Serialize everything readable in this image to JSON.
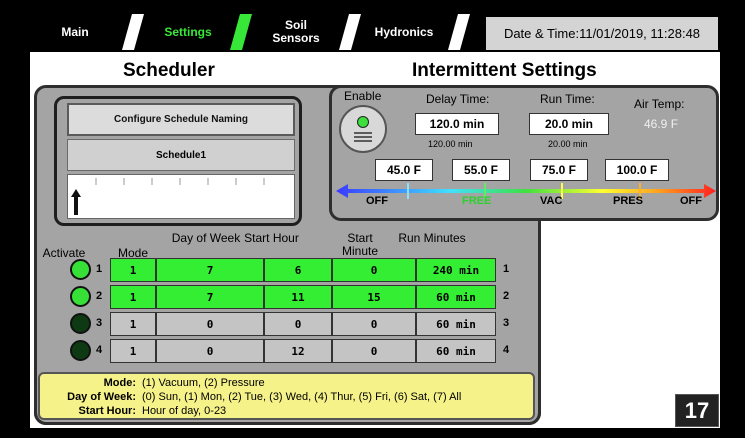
{
  "tabs": [
    {
      "label": "Main",
      "active": false
    },
    {
      "label": "Settings",
      "active": true
    },
    {
      "label": "Soil Sensors",
      "active": false
    },
    {
      "label": "Hydronics",
      "active": false
    }
  ],
  "datetime": "Date & Time:11/01/2019, 11:28:48",
  "scheduler": {
    "title": "Scheduler",
    "configure_label": "Configure Schedule Naming",
    "schedule_name": "Schedule1"
  },
  "table": {
    "headers": {
      "activate": "Activate",
      "mode": "Mode",
      "day": "Day of Week",
      "start_hour": "Start Hour",
      "start_minute": "Start Minute",
      "run": "Run Minutes"
    },
    "rows": [
      {
        "active": true,
        "num": "1",
        "mode": "1",
        "day": "7",
        "hour": "6",
        "minute": "0",
        "run": "240 min",
        "tail": "1"
      },
      {
        "active": true,
        "num": "2",
        "mode": "1",
        "day": "7",
        "hour": "11",
        "minute": "15",
        "run": "60 min",
        "tail": "2"
      },
      {
        "active": false,
        "num": "3",
        "mode": "1",
        "day": "0",
        "hour": "0",
        "minute": "0",
        "run": "60 min",
        "tail": "3"
      },
      {
        "active": false,
        "num": "4",
        "mode": "1",
        "day": "0",
        "hour": "12",
        "minute": "0",
        "run": "60 min",
        "tail": "4"
      }
    ]
  },
  "legend": {
    "mode_key": "Mode:",
    "mode_val": "(1) Vacuum, (2) Pressure",
    "day_key": "Day of Week:",
    "day_val": "(0) Sun, (1) Mon, (2) Tue, (3) Wed, (4) Thur, (5) Fri, (6) Sat, (7) All",
    "hour_key": "Start Hour:",
    "hour_val": "Hour of day, 0-23"
  },
  "intermittent": {
    "title": "Intermittent Settings",
    "enable_label": "Enable",
    "delay_label": "Delay Time:",
    "delay_value": "120.0 min",
    "delay_sub": "120.00 min",
    "run_label": "Run Time:",
    "run_value": "20.0 min",
    "run_sub": "20.00 min",
    "air_label": "Air Temp:",
    "air_value": "46.9 F",
    "thresholds": [
      "45.0 F",
      "55.0 F",
      "75.0 F",
      "100.0 F"
    ],
    "scale_labels": [
      {
        "text": "OFF",
        "color": "#000000"
      },
      {
        "text": "FREE",
        "color": "#2cd12c"
      },
      {
        "text": "VAC",
        "color": "#000000"
      },
      {
        "text": "PRES",
        "color": "#000000"
      },
      {
        "text": "OFF",
        "color": "#000000"
      }
    ]
  },
  "page_number": "17"
}
